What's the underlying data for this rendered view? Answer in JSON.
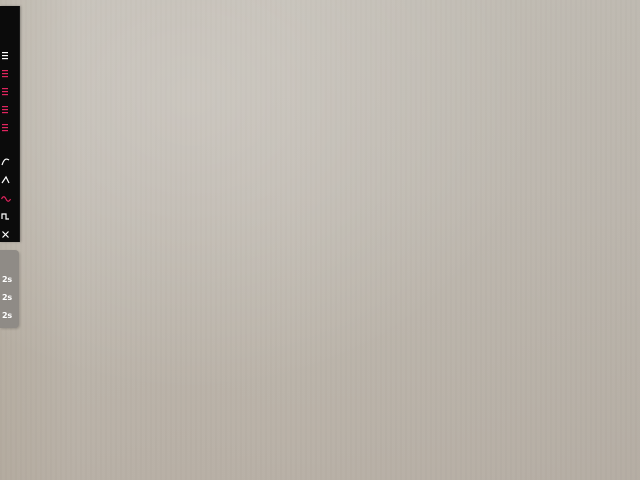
{
  "toolbar": {
    "accent_color": "#e0245e",
    "icon_color": "#ffffff",
    "list_tools": [
      {
        "icon": "list-icon",
        "color": "#e0245e"
      },
      {
        "icon": "list-icon",
        "color": "#e0245e"
      },
      {
        "icon": "list-icon",
        "color": "#e0245e"
      },
      {
        "icon": "list-icon",
        "color": "#e0245e"
      },
      {
        "icon": "list-icon",
        "color": "#e0245e"
      }
    ],
    "shape_tools": [
      {
        "icon": "curve-icon",
        "color": "#ffffff"
      },
      {
        "icon": "line-icon",
        "color": "#ffffff"
      },
      {
        "icon": "wave-icon",
        "color": "#e0245e"
      },
      {
        "icon": "step-icon",
        "color": "#ffffff"
      },
      {
        "icon": "close-icon",
        "color": "#ffffff"
      }
    ]
  },
  "speed_panel": {
    "background": "#8f8b86",
    "items": [
      {
        "label": "2s"
      },
      {
        "label": "2s"
      },
      {
        "label": "2s"
      }
    ]
  }
}
